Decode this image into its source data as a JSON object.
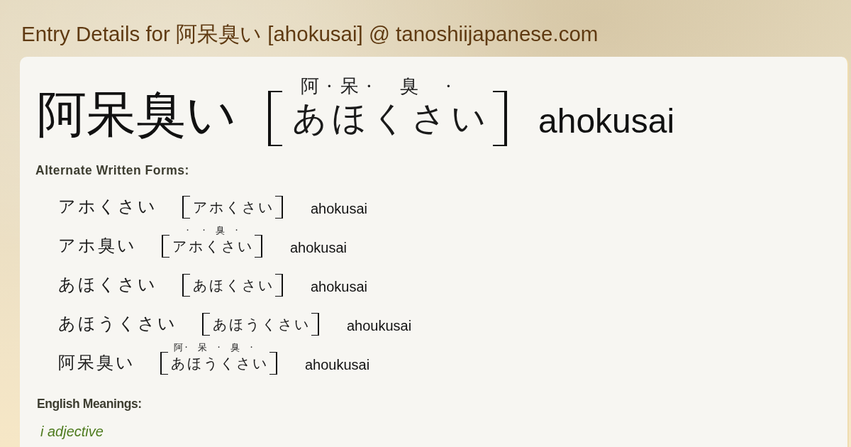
{
  "page_title": "Entry Details for 阿呆臭い [ahokusai] @ tanoshiijapanese.com",
  "entry": {
    "word": "阿呆臭い",
    "reading": [
      {
        "kana": "あ",
        "furigana": "阿",
        "separator": "·"
      },
      {
        "kana": "ほ",
        "furigana": "呆",
        "separator": "·"
      },
      {
        "kana": "くさ",
        "furigana": "臭",
        "separator": "·"
      },
      {
        "kana": "い"
      }
    ],
    "romaji": "ahokusai"
  },
  "alternate_forms": {
    "heading": "Alternate Written Forms:",
    "items": [
      {
        "word": "アホくさい",
        "reading": [
          {
            "kana": "アホくさい"
          }
        ],
        "romaji": "ahokusai"
      },
      {
        "word": "アホ臭い",
        "reading": [
          {
            "kana": "ア",
            "separator": "·"
          },
          {
            "kana": "ホ",
            "separator": "·"
          },
          {
            "kana": "くさ",
            "furigana": "臭",
            "separator": "·"
          },
          {
            "kana": "い"
          }
        ],
        "romaji": "ahokusai"
      },
      {
        "word": "あほくさい",
        "reading": [
          {
            "kana": "あほくさい"
          }
        ],
        "romaji": "ahokusai"
      },
      {
        "word": "あほうくさい",
        "reading": [
          {
            "kana": "あほうくさい"
          }
        ],
        "romaji": "ahoukusai"
      },
      {
        "word": "阿呆臭い",
        "reading": [
          {
            "kana": "あ",
            "furigana": "阿",
            "separator": "·"
          },
          {
            "kana": "ほう",
            "furigana": "呆",
            "separator": "·"
          },
          {
            "kana": "くさ",
            "furigana": "臭",
            "separator": "·"
          },
          {
            "kana": "い"
          }
        ],
        "romaji": "ahoukusai"
      }
    ]
  },
  "meanings": {
    "heading": "English Meanings:",
    "items": [
      {
        "part_of_speech": "i adjective"
      }
    ]
  }
}
